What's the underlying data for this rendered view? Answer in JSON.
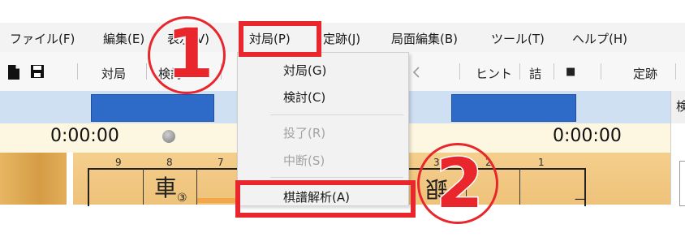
{
  "menubar": {
    "items": [
      {
        "label": "ファイル(F)"
      },
      {
        "label": "編集(E)"
      },
      {
        "label": "表示(V)"
      },
      {
        "label": "対局(P)"
      },
      {
        "label": "定跡(J)"
      },
      {
        "label": "局面編集(B)"
      },
      {
        "label": "ツール(T)"
      },
      {
        "label": "ヘルプ(H)"
      }
    ]
  },
  "toolbar": {
    "game_label": "対局",
    "study_label": "検討",
    "hint_label": "ヒント",
    "tsume_label": "詰",
    "stop_glyph": "■",
    "joseki_label": "定跡"
  },
  "panel_tab_char": "検",
  "clocks": {
    "left": "0:00:00",
    "right": "0:00:00"
  },
  "board": {
    "file_labels": [
      "9",
      "8",
      "7",
      "3",
      "2",
      "1"
    ],
    "pieces": {
      "rook": "車",
      "rook_badge": "③",
      "silver": "銀"
    },
    "rank_mark": "一"
  },
  "dropdown": {
    "items": [
      {
        "label": "対局(G)",
        "enabled": true
      },
      {
        "label": "検討(C)",
        "enabled": true
      },
      {
        "label": "投了(R)",
        "enabled": false
      },
      {
        "label": "中断(S)",
        "enabled": false
      },
      {
        "label": "棋譜解析(A)",
        "enabled": true
      }
    ]
  },
  "annotations": {
    "step1": "1",
    "step2": "2",
    "color": "#e8262b"
  }
}
